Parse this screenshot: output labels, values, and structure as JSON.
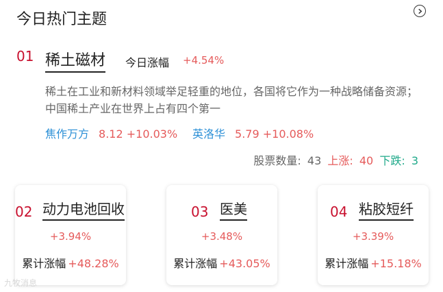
{
  "header": {
    "title": "今日热门主题",
    "more_icon": "chevron-right-circle-icon"
  },
  "main_topic": {
    "rank": "01",
    "name": "稀土磁材",
    "today_label": "今日涨幅",
    "today_value": "+4.54%",
    "description": "稀土在工业和新材料领域举足轻重的地位，各国将它作为一种战略储备资源；中国稀土产业在世界上占有四个第一",
    "stocks": [
      {
        "name": "焦作万方",
        "price": "8.12",
        "change": "+10.03%"
      },
      {
        "name": "英洛华",
        "price": "5.79",
        "change": "+10.08%"
      }
    ],
    "stats": {
      "count_label": "股票数量:",
      "count_value": "43",
      "up_label": "上涨:",
      "up_value": "40",
      "down_label": "下跌:",
      "down_value": "3"
    }
  },
  "cards": [
    {
      "rank": "02",
      "name": "动力电池回收",
      "change": "+3.94%",
      "cum_label": "累计涨幅",
      "cum_value": "+48.28%"
    },
    {
      "rank": "03",
      "name": "医美",
      "change": "+3.48%",
      "cum_label": "累计涨幅",
      "cum_value": "+43.05%"
    },
    {
      "rank": "04",
      "name": "粘胶短纤",
      "change": "+3.39%",
      "cum_label": "累计涨幅",
      "cum_value": "+15.18%"
    }
  ],
  "watermark": "九牧消息",
  "colors": {
    "rank": "#c8102e",
    "up": "#e55a5a",
    "down": "#1fa98a",
    "link": "#2b8fd6"
  }
}
